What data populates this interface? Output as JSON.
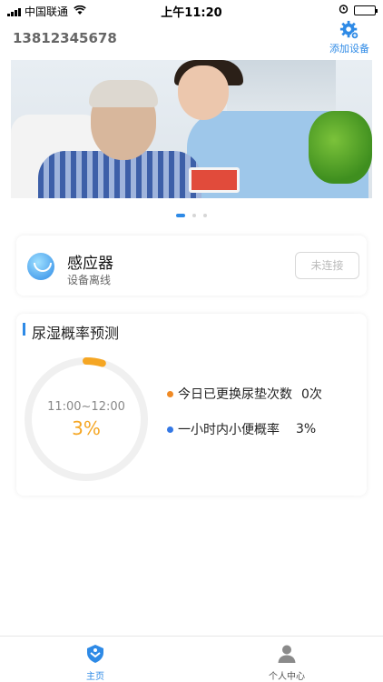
{
  "status_bar": {
    "carrier": "中国联通",
    "time": "上午11:20",
    "battery_color": "#34c759"
  },
  "header": {
    "phone": "13812345678",
    "add_device_label": "添加设备",
    "add_device_icon": "gear-plus-icon"
  },
  "banner": {
    "pages": 3,
    "active_page": 1
  },
  "sensor": {
    "name": "感应器",
    "status": "设备离线",
    "button_label": "未连接",
    "icon": "sensor-icon"
  },
  "prediction": {
    "title": "尿湿概率预测",
    "time_range": "11:00~12:00",
    "percent": "3%",
    "ring_fraction": 0.03,
    "legend": [
      {
        "label": "今日已更换尿垫次数",
        "value": "0次",
        "color": "#f08a24"
      },
      {
        "label": "一小时内小便概率",
        "value": "3%",
        "color": "#3478e5"
      }
    ]
  },
  "tabbar": {
    "items": [
      {
        "label": "主页",
        "icon": "home-shield-icon",
        "active": true
      },
      {
        "label": "个人中心",
        "icon": "person-icon",
        "active": false
      }
    ]
  },
  "colors": {
    "accent": "#2e8ae6",
    "ring_track": "#f0f0f0",
    "ring_progress": "#f5a623"
  }
}
